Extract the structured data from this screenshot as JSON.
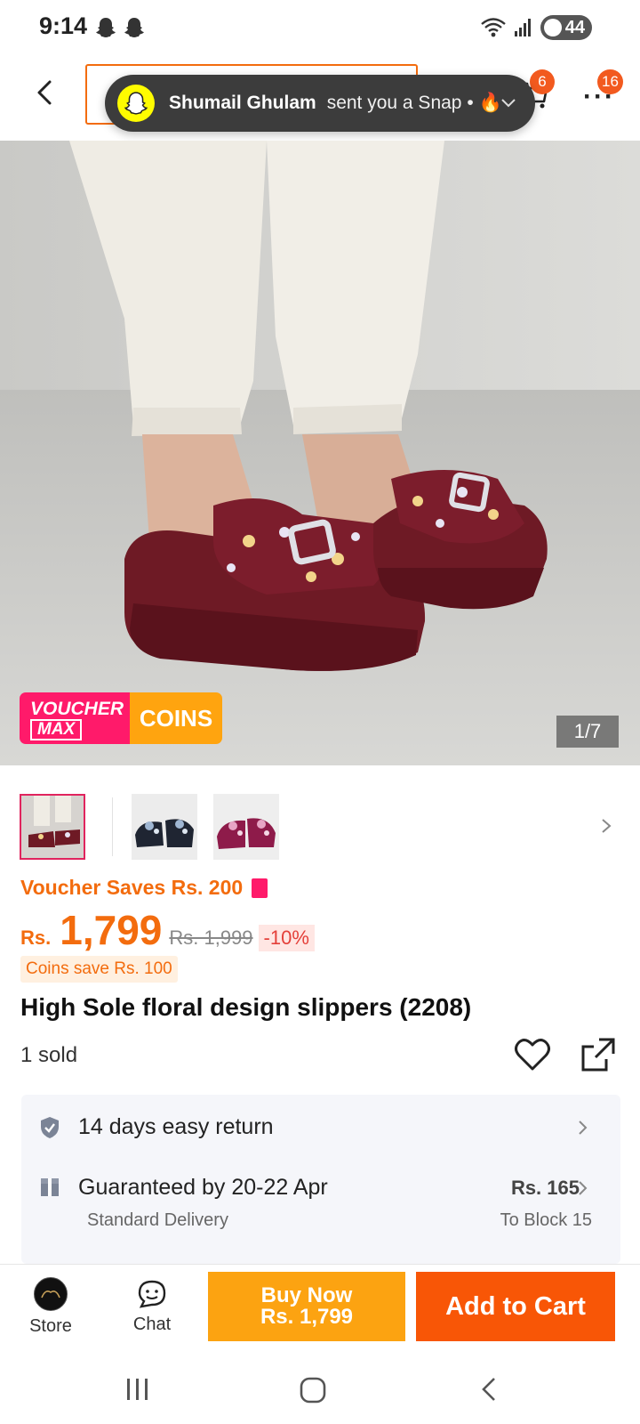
{
  "status_bar": {
    "time": "9:14",
    "notification_icons": [
      "snapchat-ghost-icon",
      "snapchat-ghost-icon"
    ],
    "battery": "44"
  },
  "header": {
    "cart_badge": "6",
    "more_badge": "16"
  },
  "notification": {
    "app": "Snapchat",
    "sender": "Shumail Ghulam",
    "message": "sent you a Snap • 🔥"
  },
  "gallery": {
    "counter": "1/7",
    "voucher_label": "VOUCHER",
    "voucher_label_2": "MAX",
    "coins_label": "COINS",
    "thumbnail_count": 3
  },
  "price": {
    "voucher_saves": "Voucher Saves Rs. 200",
    "currency": "Rs.",
    "current": "1,799",
    "original": "Rs. 1,999",
    "discount": "-10%",
    "coins_save": "Coins save Rs. 100"
  },
  "product": {
    "title": "High Sole floral design slippers (2208)",
    "sold": "1 sold"
  },
  "services": {
    "return_text": "14 days easy return",
    "delivery_text": "Guaranteed by 20-22 Apr",
    "delivery_sub": "Standard Delivery",
    "delivery_fee": "Rs. 165",
    "delivery_location": "To Block 15"
  },
  "bottom_bar": {
    "store_label": "Store",
    "chat_label": "Chat",
    "buy_now_line1": "Buy Now",
    "buy_now_line2": "Rs. 1,799",
    "add_to_cart": "Add to Cart"
  },
  "colors": {
    "brand_orange": "#f85606",
    "price_orange": "#f36c0e",
    "buy_now_yellow": "#fca311",
    "voucher_pink": "#ff1a6a",
    "snap_yellow": "#fffc00"
  }
}
